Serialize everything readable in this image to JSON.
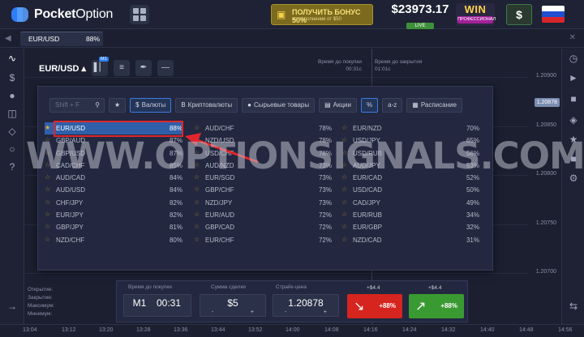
{
  "header": {
    "brand_bold": "Pocket",
    "brand_light": "Option",
    "bonus_title": "ПОЛУЧИТЬ БОНУС 50%",
    "bonus_sub": "на пополнение от $50",
    "balance": "$23973.17",
    "account_type": "LIVE",
    "win_label": "WIN",
    "win_badge": "ПРОФЕССИОНАЛ",
    "deposit_symbol": "$"
  },
  "tabs": [
    {
      "asset": "EUR/USD",
      "percent": "88%"
    }
  ],
  "chart_toolbar": {
    "asset": "EUR/USD ▴",
    "timeframe_badge": "M1",
    "time_to_purchase_label": "Время до покупки",
    "time_to_purchase_value": "00:31с",
    "time_to_close_label": "Время до закрытия",
    "time_to_close_value": "01:01с"
  },
  "price_axis": [
    "1.20900",
    "1.20878",
    "1.20850",
    "1.20800",
    "1.20750",
    "1.20700"
  ],
  "current_price": "1.20878",
  "time_axis": [
    "13:04",
    "13:12",
    "13:20",
    "13:28",
    "13:36",
    "13:44",
    "13:52",
    "14:00",
    "14:08",
    "14:16",
    "14:24",
    "14:32",
    "14:40",
    "14:48",
    "14:56"
  ],
  "stats_labels": [
    "Открытие:",
    "Закрытие:",
    "Максимум:",
    "Минимум:"
  ],
  "filters": {
    "search_placeholder": "Shift + F",
    "currencies": "Валюты",
    "crypto": "Криптовалюты",
    "commodities": "Сырьевые товары",
    "stocks": "Акции",
    "percent": "%",
    "az": "a-z",
    "schedule": "Расписание"
  },
  "assets": {
    "col1": [
      {
        "name": "EUR/USD",
        "pct": "88%",
        "fav": true
      },
      {
        "name": "GBP/AUD",
        "pct": "87%"
      },
      {
        "name": "GBP/USD",
        "pct": "87%"
      },
      {
        "name": "CAD/CHF",
        "pct": "85%"
      },
      {
        "name": "AUD/CAD",
        "pct": "84%"
      },
      {
        "name": "AUD/USD",
        "pct": "84%"
      },
      {
        "name": "CHF/JPY",
        "pct": "82%"
      },
      {
        "name": "EUR/JPY",
        "pct": "82%"
      },
      {
        "name": "GBP/JPY",
        "pct": "81%"
      },
      {
        "name": "NZD/CHF",
        "pct": "80%"
      }
    ],
    "col2": [
      {
        "name": "AUD/CHF",
        "pct": "78%"
      },
      {
        "name": "NZD/USD",
        "pct": "78%"
      },
      {
        "name": "USD/CHF",
        "pct": "78%"
      },
      {
        "name": "AUD/NZD",
        "pct": "73%"
      },
      {
        "name": "EUR/SGD",
        "pct": "73%"
      },
      {
        "name": "GBP/CHF",
        "pct": "73%"
      },
      {
        "name": "NZD/JPY",
        "pct": "73%"
      },
      {
        "name": "EUR/AUD",
        "pct": "72%"
      },
      {
        "name": "GBP/CAD",
        "pct": "72%"
      },
      {
        "name": "EUR/CHF",
        "pct": "72%"
      }
    ],
    "col3": [
      {
        "name": "EUR/NZD",
        "pct": "70%"
      },
      {
        "name": "USD/JPY",
        "pct": "65%"
      },
      {
        "name": "USD/RUB",
        "pct": "56%"
      },
      {
        "name": "AUD/JPY",
        "pct": "53%"
      },
      {
        "name": "EUR/CAD",
        "pct": "52%"
      },
      {
        "name": "USD/CAD",
        "pct": "50%"
      },
      {
        "name": "CAD/JPY",
        "pct": "49%"
      },
      {
        "name": "EUR/RUB",
        "pct": "34%"
      },
      {
        "name": "EUR/GBP",
        "pct": "32%"
      },
      {
        "name": "NZD/CAD",
        "pct": "31%"
      }
    ]
  },
  "watermark": "WWW.OPTIONSIGNALS.COM",
  "trade_panel": {
    "time_label": "Время до покупки",
    "timeframe": "M1",
    "time_value": "00:31",
    "amount_label": "Сумма сделки",
    "amount_value": "$5",
    "strike_label": "Страйк-цена",
    "strike_value": "1.20878",
    "down_top": "+$4.4",
    "down_pct": "+88%",
    "up_top": "+$4.4",
    "up_pct": "+88%",
    "minus": "-",
    "plus": "+"
  }
}
